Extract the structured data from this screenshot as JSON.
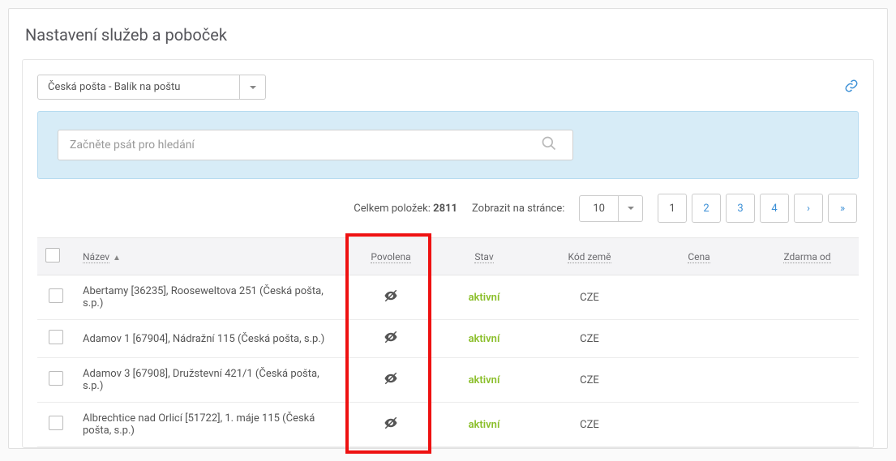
{
  "pageTitle": "Nastavení služeb a poboček",
  "serviceSelect": {
    "label": "Česká pošta - Balík na poštu"
  },
  "search": {
    "placeholder": "Začněte psát pro hledání"
  },
  "listControls": {
    "totalLabel": "Celkem položek:",
    "totalCount": "2811",
    "perPageLabel": "Zobrazit na stránce:",
    "perPageValue": "10"
  },
  "pager": {
    "pages": [
      "1",
      "2",
      "3",
      "4"
    ],
    "next": "›",
    "last": "»"
  },
  "tableHead": {
    "name": "Název",
    "allowed": "Povolena",
    "state": "Stav",
    "country": "Kód země",
    "price": "Cena",
    "freeFrom": "Zdarma od"
  },
  "rows": [
    {
      "name": "Abertamy [36235], Rooseweltova 251 (Česká pošta, s.p.)",
      "state": "aktivní",
      "country": "CZE"
    },
    {
      "name": "Adamov 1 [67904], Nádražní 115 (Česká pošta, s.p.)",
      "state": "aktivní",
      "country": "CZE"
    },
    {
      "name": "Adamov 3 [67908], Družstevní 421/1 (Česká pošta, s.p.)",
      "state": "aktivní",
      "country": "CZE"
    },
    {
      "name": "Albrechtice nad Orlicí [51722], 1. máje 115 (Česká pošta, s.p.)",
      "state": "aktivní",
      "country": "CZE"
    }
  ]
}
